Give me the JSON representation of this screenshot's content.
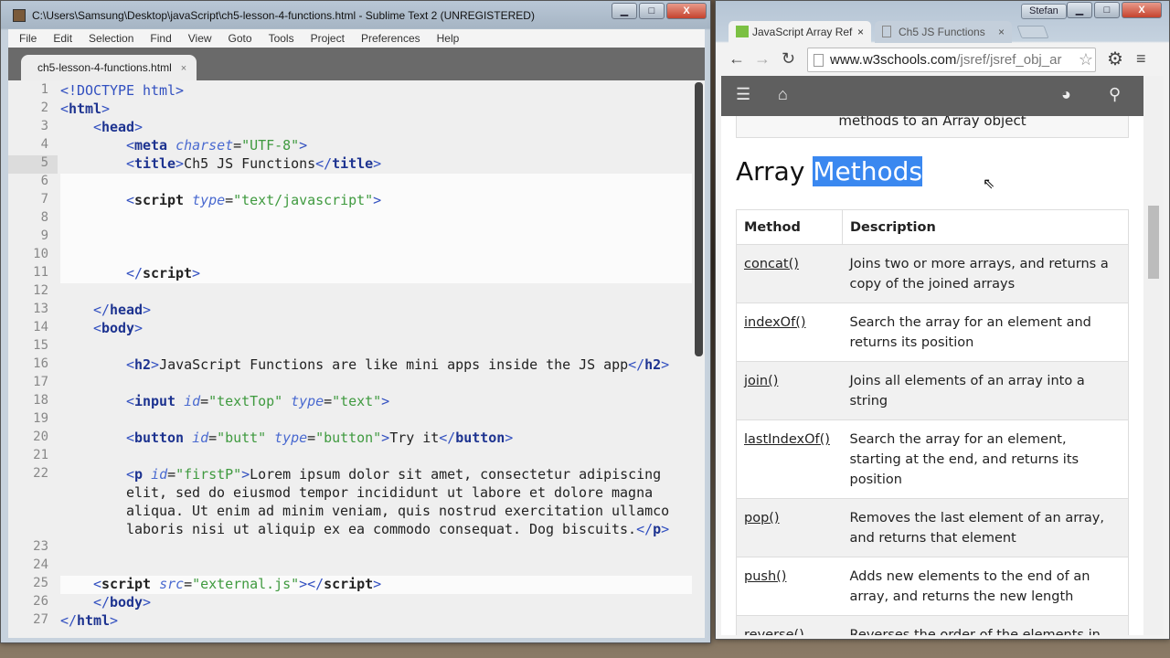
{
  "editor_window": {
    "title": "C:\\Users\\Samsung\\Desktop\\javaScript\\ch5-lesson-4-functions.html - Sublime Text 2 (UNREGISTERED)",
    "menu": [
      "File",
      "Edit",
      "Selection",
      "Find",
      "View",
      "Goto",
      "Tools",
      "Project",
      "Preferences",
      "Help"
    ],
    "tab": {
      "label": "ch5-lesson-4-functions.html",
      "close": "×"
    },
    "current_line": 5,
    "lines": [
      {
        "n": "1",
        "ind": "",
        "tk": [
          [
            "b",
            "<!DOCTYPE html>"
          ]
        ]
      },
      {
        "n": "2",
        "ind": "",
        "tk": [
          [
            "b",
            "<"
          ],
          [
            "t",
            "html"
          ],
          [
            "b",
            ">"
          ]
        ]
      },
      {
        "n": "3",
        "ind": "    ",
        "tk": [
          [
            "b",
            "<"
          ],
          [
            "t",
            "head"
          ],
          [
            "b",
            ">"
          ]
        ]
      },
      {
        "n": "4",
        "ind": "        ",
        "tk": [
          [
            "b",
            "<"
          ],
          [
            "t",
            "meta"
          ],
          [
            "x",
            " "
          ],
          [
            "a",
            "charset"
          ],
          [
            "x",
            "="
          ],
          [
            "v",
            "\"UTF-8\""
          ],
          [
            "b",
            ">"
          ]
        ]
      },
      {
        "n": "5",
        "ind": "        ",
        "tk": [
          [
            "b",
            "<"
          ],
          [
            "t",
            "title"
          ],
          [
            "b",
            ">"
          ],
          [
            "x",
            "Ch5 JS Functions"
          ],
          [
            "b",
            "</"
          ],
          [
            "t",
            "title"
          ],
          [
            "b",
            ">"
          ]
        ]
      },
      {
        "n": "6",
        "ind": "",
        "tk": [],
        "hl": true
      },
      {
        "n": "7",
        "ind": "        ",
        "tk": [
          [
            "b",
            "<"
          ],
          [
            "s",
            "script"
          ],
          [
            "x",
            " "
          ],
          [
            "a",
            "type"
          ],
          [
            "x",
            "="
          ],
          [
            "v",
            "\"text/javascript\""
          ],
          [
            "b",
            ">"
          ]
        ],
        "hl": true
      },
      {
        "n": "8",
        "ind": "",
        "tk": [],
        "hl": true
      },
      {
        "n": "9",
        "ind": "",
        "tk": [],
        "hl": true
      },
      {
        "n": "10",
        "ind": "",
        "tk": [],
        "hl": true
      },
      {
        "n": "11",
        "ind": "        ",
        "tk": [
          [
            "b",
            "</"
          ],
          [
            "s",
            "script"
          ],
          [
            "b",
            ">"
          ]
        ],
        "hl": true
      },
      {
        "n": "12",
        "ind": "",
        "tk": []
      },
      {
        "n": "13",
        "ind": "    ",
        "tk": [
          [
            "b",
            "</"
          ],
          [
            "t",
            "head"
          ],
          [
            "b",
            ">"
          ]
        ]
      },
      {
        "n": "14",
        "ind": "    ",
        "tk": [
          [
            "b",
            "<"
          ],
          [
            "t",
            "body"
          ],
          [
            "b",
            ">"
          ]
        ]
      },
      {
        "n": "15",
        "ind": "",
        "tk": []
      },
      {
        "n": "16",
        "ind": "        ",
        "tk": [
          [
            "b",
            "<"
          ],
          [
            "t",
            "h2"
          ],
          [
            "b",
            ">"
          ],
          [
            "x",
            "JavaScript Functions are like mini apps inside the JS app"
          ],
          [
            "b",
            "</"
          ],
          [
            "t",
            "h2"
          ],
          [
            "b",
            ">"
          ]
        ]
      },
      {
        "n": "17",
        "ind": "",
        "tk": []
      },
      {
        "n": "18",
        "ind": "        ",
        "tk": [
          [
            "b",
            "<"
          ],
          [
            "t",
            "input"
          ],
          [
            "x",
            " "
          ],
          [
            "a",
            "id"
          ],
          [
            "x",
            "="
          ],
          [
            "v",
            "\"textTop\""
          ],
          [
            "x",
            " "
          ],
          [
            "a",
            "type"
          ],
          [
            "x",
            "="
          ],
          [
            "v",
            "\"text\""
          ],
          [
            "b",
            ">"
          ]
        ]
      },
      {
        "n": "19",
        "ind": "",
        "tk": []
      },
      {
        "n": "20",
        "ind": "        ",
        "tk": [
          [
            "b",
            "<"
          ],
          [
            "t",
            "button"
          ],
          [
            "x",
            " "
          ],
          [
            "a",
            "id"
          ],
          [
            "x",
            "="
          ],
          [
            "v",
            "\"butt\""
          ],
          [
            "x",
            " "
          ],
          [
            "a",
            "type"
          ],
          [
            "x",
            "="
          ],
          [
            "v",
            "\"button\""
          ],
          [
            "b",
            ">"
          ],
          [
            "x",
            "Try it"
          ],
          [
            "b",
            "</"
          ],
          [
            "t",
            "button"
          ],
          [
            "b",
            ">"
          ]
        ]
      },
      {
        "n": "21",
        "ind": "",
        "tk": []
      },
      {
        "n": "22",
        "ind": "        ",
        "tk": [
          [
            "b",
            "<"
          ],
          [
            "t",
            "p"
          ],
          [
            "x",
            " "
          ],
          [
            "a",
            "id"
          ],
          [
            "x",
            "="
          ],
          [
            "v",
            "\"firstP\""
          ],
          [
            "b",
            ">"
          ],
          [
            "x",
            "Lorem ipsum dolor sit amet, consectetur adipiscing"
          ]
        ]
      },
      {
        "n": "",
        "ind": "        ",
        "tk": [
          [
            "x",
            "elit, sed do eiusmod tempor incididunt ut labore et dolore magna"
          ]
        ]
      },
      {
        "n": "",
        "ind": "        ",
        "tk": [
          [
            "x",
            "aliqua. Ut enim ad minim veniam, quis nostrud exercitation ullamco"
          ]
        ]
      },
      {
        "n": "",
        "ind": "        ",
        "tk": [
          [
            "x",
            "laboris nisi ut aliquip ex ea commodo consequat. Dog biscuits."
          ],
          [
            "b",
            "</"
          ],
          [
            "t",
            "p"
          ],
          [
            "b",
            ">"
          ]
        ]
      },
      {
        "n": "23",
        "ind": "",
        "tk": []
      },
      {
        "n": "24",
        "ind": "",
        "tk": []
      },
      {
        "n": "25",
        "ind": "    ",
        "tk": [
          [
            "b",
            "<"
          ],
          [
            "s",
            "script"
          ],
          [
            "x",
            " "
          ],
          [
            "a",
            "src"
          ],
          [
            "x",
            "="
          ],
          [
            "v",
            "\"external.js\""
          ],
          [
            "b",
            "></"
          ],
          [
            "s",
            "script"
          ],
          [
            "b",
            ">"
          ]
        ],
        "hl": true
      },
      {
        "n": "26",
        "ind": "    ",
        "tk": [
          [
            "b",
            "</"
          ],
          [
            "t",
            "body"
          ],
          [
            "b",
            ">"
          ]
        ]
      },
      {
        "n": "27",
        "ind": "",
        "tk": [
          [
            "b",
            "</"
          ],
          [
            "t",
            "html"
          ],
          [
            "b",
            ">"
          ]
        ]
      }
    ]
  },
  "browser": {
    "user": "Stefan",
    "tabs": [
      {
        "label": "JavaScript Array Ref",
        "close": "×"
      },
      {
        "label": "Ch5 JS Functions",
        "close": "×"
      }
    ],
    "url_host": "www.w3schools.com",
    "url_path": "/jsref/jsref_obj_ar",
    "page": {
      "note_text": "methods to an Array object",
      "heading_plain": "Array ",
      "heading_selected": "Methods",
      "table_headers": [
        "Method",
        "Description"
      ],
      "rows": [
        {
          "method": "concat()",
          "desc": "Joins two or more arrays, and returns a copy of the joined arrays"
        },
        {
          "method": "indexOf()",
          "desc": "Search the array for an element and returns its position"
        },
        {
          "method": "join()",
          "desc": "Joins all elements of an array into a string"
        },
        {
          "method": "lastIndexOf()",
          "desc": "Search the array for an element, starting at the end, and returns its position"
        },
        {
          "method": "pop()",
          "desc": "Removes the last element of an array, and returns that element"
        },
        {
          "method": "push()",
          "desc": "Adds new elements to the end of an array, and returns the new length"
        },
        {
          "method": "reverse()",
          "desc": "Reverses the order of the elements in"
        }
      ]
    }
  }
}
